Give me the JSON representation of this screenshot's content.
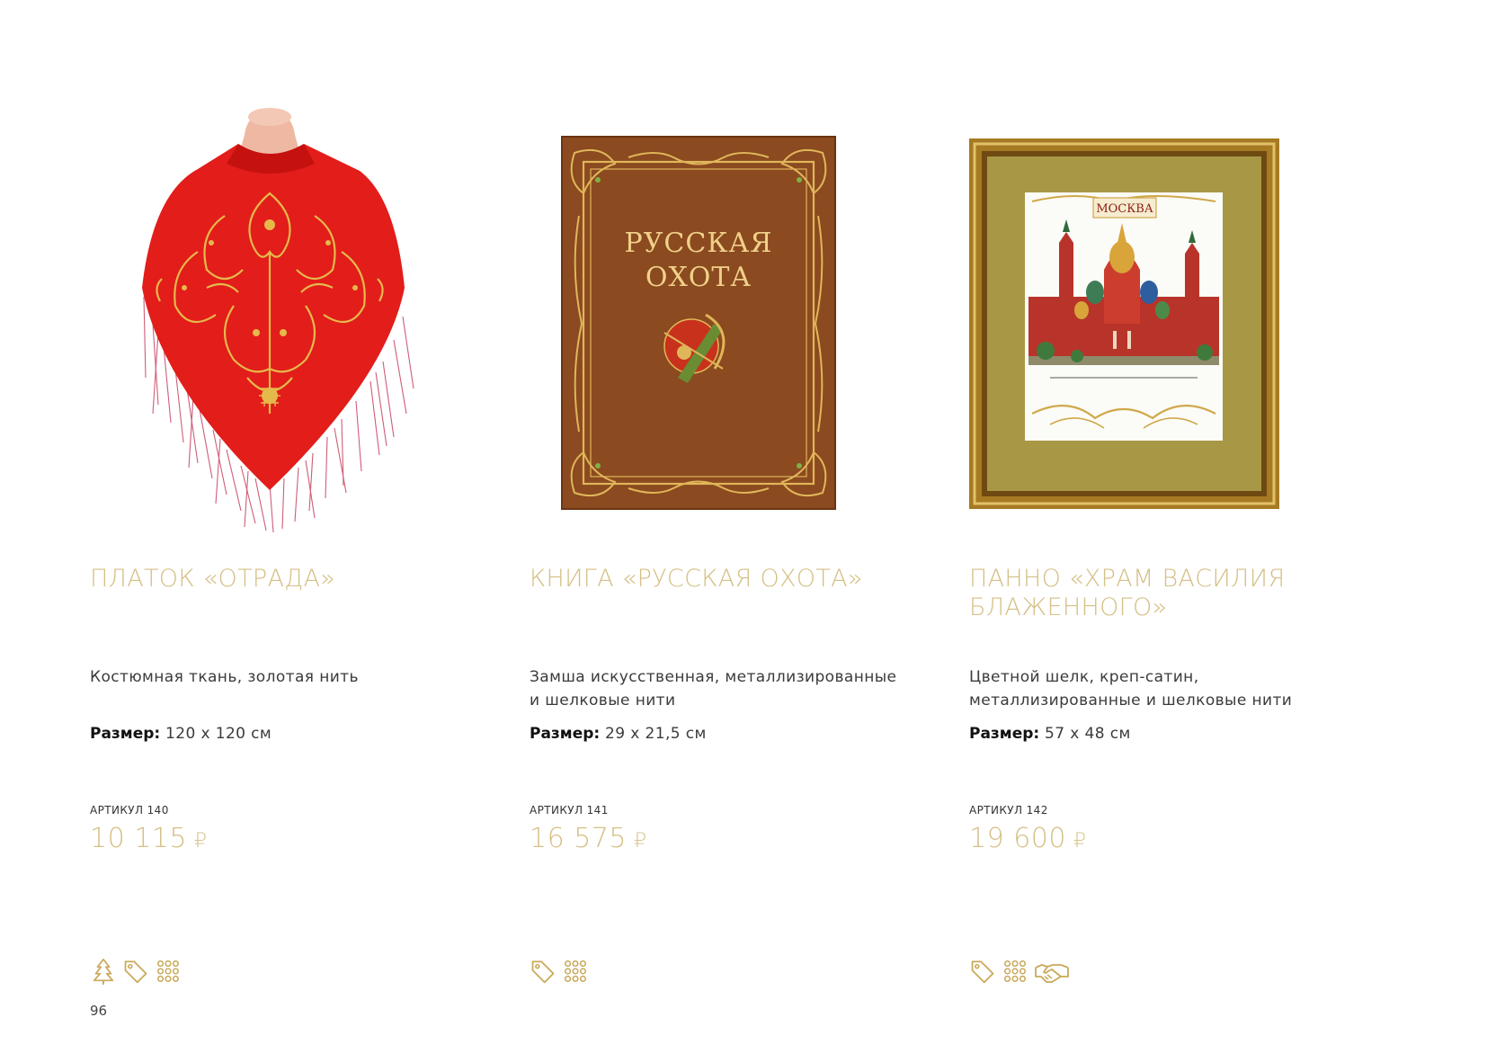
{
  "products": [
    {
      "title": "Платок «Отрада»",
      "material": "Костюмная ткань, золотая нить",
      "size_label": "Размер:",
      "size_value": "120 х 120 см",
      "article": "АРТИКУЛ 140",
      "price": "10 115",
      "currency": "₽",
      "icons": [
        "tree-icon",
        "tag-icon",
        "grid-dots-icon"
      ]
    },
    {
      "title": "Книга «Русская охота»",
      "material": "Замша искусственная, металлизированные и шелковые нити",
      "size_label": "Размер:",
      "size_value": "29 х 21,5 см",
      "article": "АРТИКУЛ 141",
      "price": "16 575",
      "currency": "₽",
      "cover_line1": "РУССКАЯ",
      "cover_line2": "ОХОТА",
      "icons": [
        "tag-icon",
        "grid-dots-icon"
      ]
    },
    {
      "title": "Панно «Храм Василия Блаженного»",
      "material": "Цветной шелк, креп-сатин, металлизированные и шелковые нити",
      "size_label": "Размер:",
      "size_value": "57 х 48 см",
      "article": "АРТИКУЛ 142",
      "price": "19 600",
      "currency": "₽",
      "panel_caption": "МОСКВА",
      "icons": [
        "tag-icon",
        "grid-dots-icon",
        "handshake-icon"
      ]
    }
  ],
  "page_number": "96",
  "colors": {
    "accent_gold": "#d5bf85",
    "shawl_red": "#e0201c",
    "book_brown": "#8a4a1e",
    "frame_gold": "#b38a2e"
  }
}
